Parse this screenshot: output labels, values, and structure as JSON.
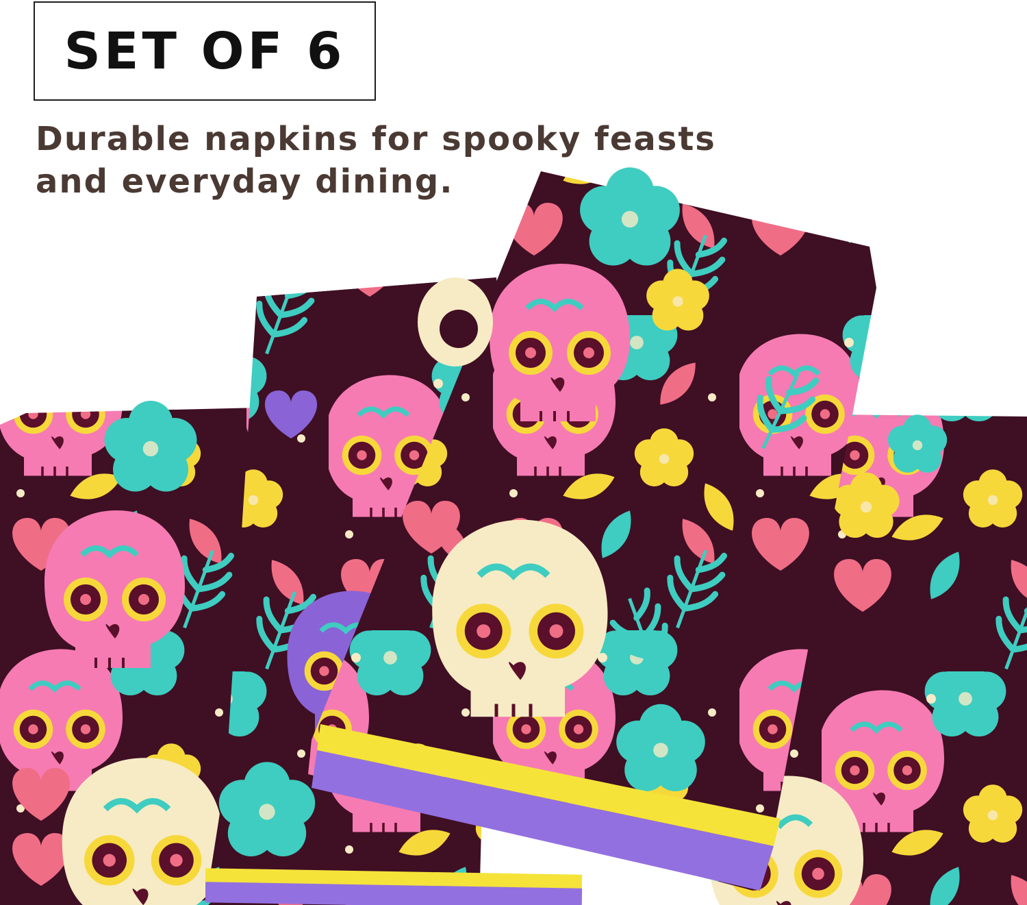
{
  "badge": {
    "label": "SET OF 6"
  },
  "tagline": {
    "text": "Durable napkins for spooky feasts and everyday dining."
  },
  "colors": {
    "fabric": "#3f0f24",
    "teal": "#3ecdc0",
    "yellow": "#f7d83b",
    "pink": "#f06d86",
    "purple": "#8a63d6",
    "cream": "#f7ebc5",
    "border_purple": "#9370e0",
    "border_yellow": "#f5e33a"
  },
  "icons": [
    "sugar-skull-icon",
    "flower-icon",
    "heart-icon",
    "leaf-icon",
    "branch-icon"
  ]
}
